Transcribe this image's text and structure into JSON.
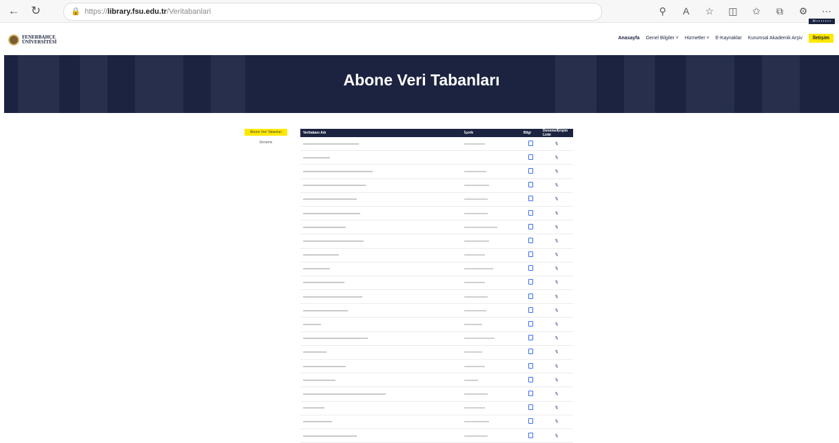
{
  "browser": {
    "back_icon": "←",
    "reload_icon": "↻",
    "lock_icon": "🔒",
    "url_prefix": "https://",
    "url_domain": "library.fsu.edu.tr",
    "url_path": "/Veritabanlari",
    "tools": [
      "zoom-icon",
      "read-aloud-icon",
      "favorite-icon",
      "split-screen-icon",
      "favorites-icon",
      "collections-icon",
      "extensions-icon",
      "more-icon"
    ]
  },
  "site": {
    "logo_line1": "FENERBAHÇE",
    "logo_line2": "ÜNİVERSİTESİ",
    "nav": [
      {
        "label": "Anasayfa",
        "active": true
      },
      {
        "label": "Genel Bilgiler ˅",
        "active": false
      },
      {
        "label": "Hizmetler ˅",
        "active": false
      },
      {
        "label": "E-Kaynaklar",
        "active": false
      },
      {
        "label": "Kurumsal Akademik Arşiv",
        "active": false
      }
    ],
    "cta_label": "İletişim",
    "hero_title": "Abone Veri Tabanları"
  },
  "sidebar": {
    "active_button": "Abone Veri Tabanları",
    "link": "Deneme"
  },
  "table": {
    "headers": [
      "Veritabanı Adı",
      "İçerik",
      "Bilgi",
      "Deneme/Erişim Linki"
    ],
    "rows_count": 22
  },
  "colors": {
    "navy": "#1b2340",
    "yellow": "#ffe800",
    "link_blue": "#3a6cf0"
  }
}
